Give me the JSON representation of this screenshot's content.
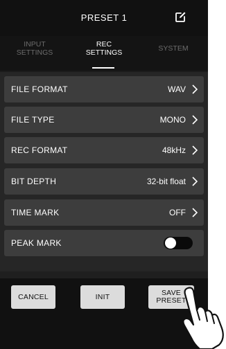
{
  "header": {
    "title": "PRESET 1",
    "edit_icon": "edit-icon"
  },
  "tabs": [
    {
      "line1": "INPUT",
      "line2": "SETTINGS",
      "active": false
    },
    {
      "line1": "REC",
      "line2": "SETTINGS",
      "active": true
    },
    {
      "line1": "SYSTEM",
      "line2": "",
      "active": false
    }
  ],
  "settings": [
    {
      "label": "FILE FORMAT",
      "value": "WAV",
      "type": "chevron"
    },
    {
      "label": "FILE TYPE",
      "value": "MONO",
      "type": "chevron"
    },
    {
      "label": "REC FORMAT",
      "value": "48kHz",
      "type": "chevron"
    },
    {
      "label": "BIT DEPTH",
      "value": "32-bit float",
      "type": "chevron"
    },
    {
      "label": "TIME MARK",
      "value": "OFF",
      "type": "chevron"
    },
    {
      "label": "PEAK MARK",
      "value": "",
      "type": "toggle",
      "toggle_on": false
    }
  ],
  "footer": {
    "cancel_label": "CANCEL",
    "init_label": "INIT",
    "save_line1": "SAVE",
    "save_line2": "PRESET"
  },
  "colors": {
    "background": "#1b1b1b",
    "row_background": "#3d3d3d",
    "button_background": "#dcdcdc",
    "text": "#ffffff",
    "inactive_tab": "#6c6c6c"
  },
  "icons": {
    "chevron": "chevron-right-icon",
    "pointer": "hand-pointer-icon"
  }
}
